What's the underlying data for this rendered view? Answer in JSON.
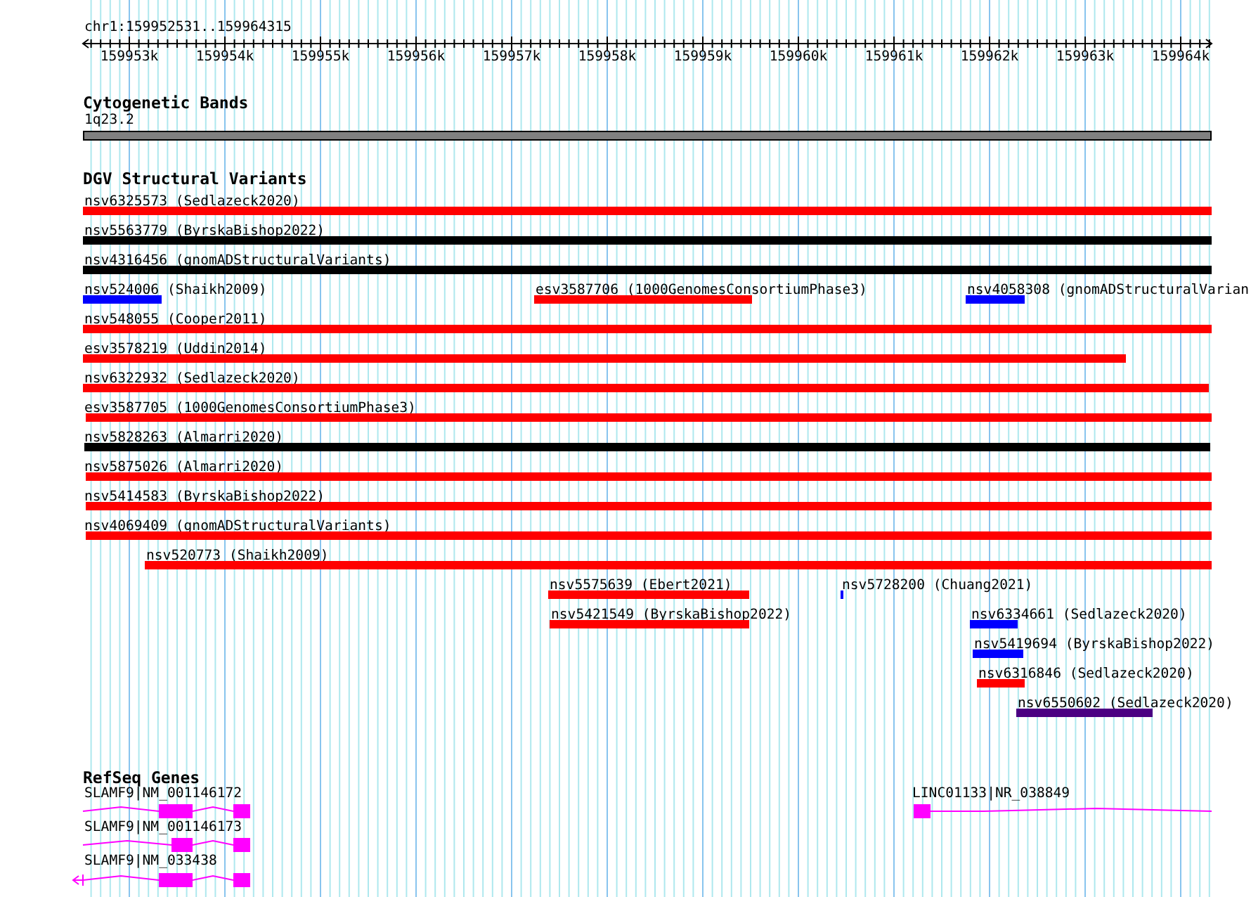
{
  "ruler": {
    "location": "chr1:159952531..159964315",
    "tick_labels": [
      "159953k",
      "159954k",
      "159955k",
      "159956k",
      "159957k",
      "159958k",
      "159959k",
      "159960k",
      "159961k",
      "159962k",
      "159963k",
      "159964k"
    ]
  },
  "cytogenetic_bands": {
    "title": "Cytogenetic Bands",
    "band_label": "1q23.2"
  },
  "dgv_structural_variants": {
    "title": "DGV Structural Variants",
    "features": [
      {
        "label": "nsv6325573 (Sedlazeck2020)",
        "color": "#ff0000"
      },
      {
        "label": "nsv5563779 (ByrskaBishop2022)",
        "color": "#000000"
      },
      {
        "label": "nsv4316456 (gnomADStructuralVariants)",
        "color": "#000000"
      },
      {
        "label": "nsv524006 (Shaikh2009)",
        "color": "#0000ff"
      },
      {
        "label": "esv3587706 (1000GenomesConsortiumPhase3)",
        "color": "#ff0000"
      },
      {
        "label": "nsv4058308 (gnomADStructuralVarian",
        "color": "#0000ff"
      },
      {
        "label": "nsv548055 (Cooper2011)",
        "color": "#ff0000"
      },
      {
        "label": "esv3578219 (Uddin2014)",
        "color": "#ff0000"
      },
      {
        "label": "nsv6322932 (Sedlazeck2020)",
        "color": "#ff0000"
      },
      {
        "label": "esv3587705 (1000GenomesConsortiumPhase3)",
        "color": "#ff0000"
      },
      {
        "label": "nsv5828263 (Almarri2020)",
        "color": "#000000"
      },
      {
        "label": "nsv5875026 (Almarri2020)",
        "color": "#ff0000"
      },
      {
        "label": "nsv5414583 (ByrskaBishop2022)",
        "color": "#ff0000"
      },
      {
        "label": "nsv4069409 (gnomADStructuralVariants)",
        "color": "#ff0000"
      },
      {
        "label": "nsv520773 (Shaikh2009)",
        "color": "#ff0000"
      },
      {
        "label": "nsv5575639 (Ebert2021)",
        "color": "#ff0000"
      },
      {
        "label": "nsv5728200 (Chuang2021)",
        "color": "#0000ff"
      },
      {
        "label": "nsv5421549 (ByrskaBishop2022)",
        "color": "#ff0000"
      },
      {
        "label": "nsv6334661 (Sedlazeck2020)",
        "color": "#0000ff"
      },
      {
        "label": "nsv5419694 (ByrskaBishop2022)",
        "color": "#0000ff"
      },
      {
        "label": "nsv6316846 (Sedlazeck2020)",
        "color": "#ff0000"
      },
      {
        "label": "nsv6550602 (Sedlazeck2020)",
        "color": "#4b0082"
      }
    ]
  },
  "refseq_genes": {
    "title": "RefSeq Genes",
    "genes": [
      {
        "label": "SLAMF9|NM_001146172"
      },
      {
        "label": "SLAMF9|NM_001146173"
      },
      {
        "label": "SLAMF9|NM_033438"
      },
      {
        "label": "LINC01133|NR_038849"
      }
    ]
  }
}
